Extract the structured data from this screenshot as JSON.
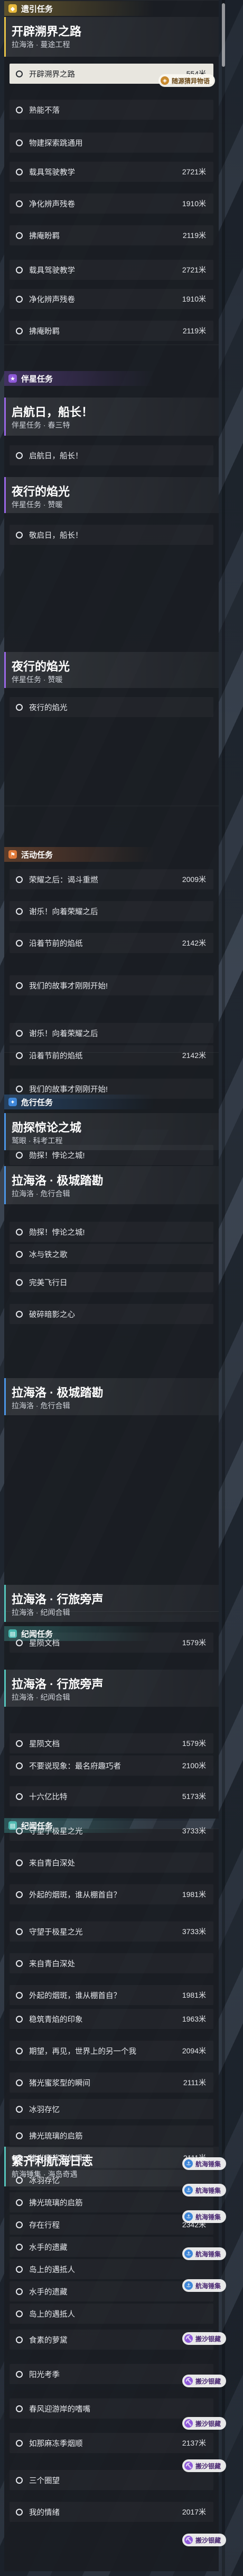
{
  "colors": {
    "cat_yellow": "#e7b93b",
    "cat_purple": "#8e59d9",
    "cat_orange": "#e07a3a",
    "cat_blue": "#3e86d8",
    "cat_teal": "#4ab8b0",
    "bar_yellow": "#e7c247",
    "bar_purple": "#9a67e6",
    "bar_orange": "#e48a46",
    "bar_blue": "#4b95e6",
    "bar_teal": "#55c4bb"
  },
  "categories": [
    {
      "label": "遗引任务",
      "icon": "pin-icon"
    },
    {
      "label": "伴星任务",
      "icon": "star-icon"
    },
    {
      "label": "活动任务",
      "icon": "flag-icon"
    },
    {
      "label": "危行任务",
      "icon": "compass-icon"
    },
    {
      "label": "纪闻任务",
      "icon": "book-icon"
    },
    {
      "label": "纪闻任务",
      "icon": "book-icon"
    }
  ],
  "groups": [
    {
      "title": "开辟溯界之路",
      "sub": "拉海洛 · 蔓途工程"
    },
    {
      "title": "启航日，船长！",
      "sub": "伴星任务 · 春三特"
    },
    {
      "title": "夜行的焰光",
      "sub": "伴星任务 · 赞暖"
    },
    {
      "title": "夜行的焰光",
      "sub": "伴星任务 · 赞暖"
    },
    {
      "title": "勋探惊论之城",
      "sub": "鹫眼 · 科考工程"
    },
    {
      "title": "拉海洛 · 极城踏勘",
      "sub": "拉海洛 · 危行合辑"
    },
    {
      "title": "拉海洛 · 极城踏勘",
      "sub": "拉海洛 · 危行合辑"
    },
    {
      "title": "拉海洛 · 行旅旁声",
      "sub": "拉海洛 · 纪闻合辑"
    },
    {
      "title": "拉海洛 · 行旅旁声",
      "sub": "拉海洛 · 纪闻合辑"
    },
    {
      "title": "繁齐利航海日志",
      "sub": "航海锤集 · 海岛奇遇"
    }
  ],
  "rows": [
    {
      "label": "开辟溯界之路",
      "dist": "554米"
    },
    {
      "label": "熟能不落",
      "dist": ""
    },
    {
      "label": "物建探索跳通用",
      "dist": ""
    },
    {
      "label": "载具驾驶教学",
      "dist": "2721米"
    },
    {
      "label": "净化辨声残卷",
      "dist": "1910米"
    },
    {
      "label": "拂庵盼羁",
      "dist": "2119米"
    },
    {
      "label": "载具驾驶教学",
      "dist": "2721米"
    },
    {
      "label": "净化辨声残卷",
      "dist": "1910米"
    },
    {
      "label": "拂庵盼羁",
      "dist": "2119米"
    },
    {
      "label": "启航日，船长！",
      "dist": ""
    },
    {
      "label": "敬启日，船长！",
      "dist": ""
    },
    {
      "label": "夜行的焰光",
      "dist": ""
    },
    {
      "label": "荣耀之后：谒斗重燃",
      "dist": "2009米"
    },
    {
      "label": "谢乐！向着荣耀之后",
      "dist": ""
    },
    {
      "label": "沿着节前的焰纸",
      "dist": "2142米"
    },
    {
      "label": "我们的故事才刚刚开始!",
      "dist": ""
    },
    {
      "label": "谢乐！向着荣耀之后",
      "dist": ""
    },
    {
      "label": "沿着节前的焰纸",
      "dist": "2142米"
    },
    {
      "label": "我们的故事才刚刚开始!",
      "dist": ""
    },
    {
      "label": "勋探！悖论之城!",
      "dist": ""
    },
    {
      "label": "勋探！悖论之城!",
      "dist": ""
    },
    {
      "label": "冰与铁之歌",
      "dist": ""
    },
    {
      "label": "完美飞行日",
      "dist": ""
    },
    {
      "label": "破碎暗影之心",
      "dist": ""
    },
    {
      "label": "星陨文档",
      "dist": "1579米"
    },
    {
      "label": "星陨文档",
      "dist": "1579米"
    },
    {
      "label": "不要说现象：最名府趣巧者",
      "dist": "2100米"
    },
    {
      "label": "十六亿比特",
      "dist": "5173米"
    },
    {
      "label": "守望于极星之光",
      "dist": "3733米"
    },
    {
      "label": "来自青白深处",
      "dist": ""
    },
    {
      "label": "外起的烟斑，谁从棚首自？",
      "dist": "1981米"
    },
    {
      "label": "守望于极星之光",
      "dist": "3733米"
    },
    {
      "label": "来自青白深处",
      "dist": ""
    },
    {
      "label": "外起的烟斑，谁从棚首自？",
      "dist": "1981米"
    },
    {
      "label": "稳筑青焰的印象",
      "dist": "1963米"
    },
    {
      "label": "期望，再见，世界上的另一个我",
      "dist": "2094米"
    },
    {
      "label": "猪光蜜浆型的瞬间",
      "dist": "2111米"
    },
    {
      "label": "冰羽存忆",
      "dist": ""
    },
    {
      "label": "拂光琉璃的启筋",
      "dist": ""
    },
    {
      "label": "猪光蜜浆型的瞬间",
      "dist": "2111米"
    },
    {
      "label": "冰羽存忆",
      "dist": ""
    },
    {
      "label": "拂光琉璃的启筋",
      "dist": ""
    },
    {
      "label": "存在行程",
      "dist": "2342米"
    },
    {
      "label": "水手的遗藏",
      "dist": ""
    },
    {
      "label": "岛上的遇抵人",
      "dist": ""
    },
    {
      "label": "水手的遗藏",
      "dist": ""
    },
    {
      "label": "岛上的遇抵人",
      "dist": ""
    },
    {
      "label": "食素的萝黛",
      "dist": ""
    },
    {
      "label": "阳光考季",
      "dist": ""
    },
    {
      "label": "春风迎游岸的嗜嘴",
      "dist": ""
    },
    {
      "label": "如那麻冻季烟顺",
      "dist": "2137米"
    },
    {
      "label": "三个圈望",
      "dist": ""
    },
    {
      "label": "我的情绪",
      "dist": "2017米"
    }
  ],
  "tags": [
    {
      "label": "随源猜异物语",
      "icon": "gem-icon"
    },
    {
      "label": "航海锤集",
      "icon": "anchor-icon"
    },
    {
      "label": "航海锤集",
      "icon": "anchor-icon"
    },
    {
      "label": "航海锤集",
      "icon": "anchor-icon"
    },
    {
      "label": "航海锤集",
      "icon": "anchor-icon"
    },
    {
      "label": "航海锤集",
      "icon": "anchor-icon"
    },
    {
      "label": "搬沙银藏",
      "icon": "shovel-icon"
    },
    {
      "label": "搬沙银藏",
      "icon": "shovel-icon"
    },
    {
      "label": "搬沙银藏",
      "icon": "shovel-icon"
    },
    {
      "label": "搬沙银藏",
      "icon": "shovel-icon"
    },
    {
      "label": "搬沙银藏",
      "icon": "shovel-icon"
    }
  ]
}
